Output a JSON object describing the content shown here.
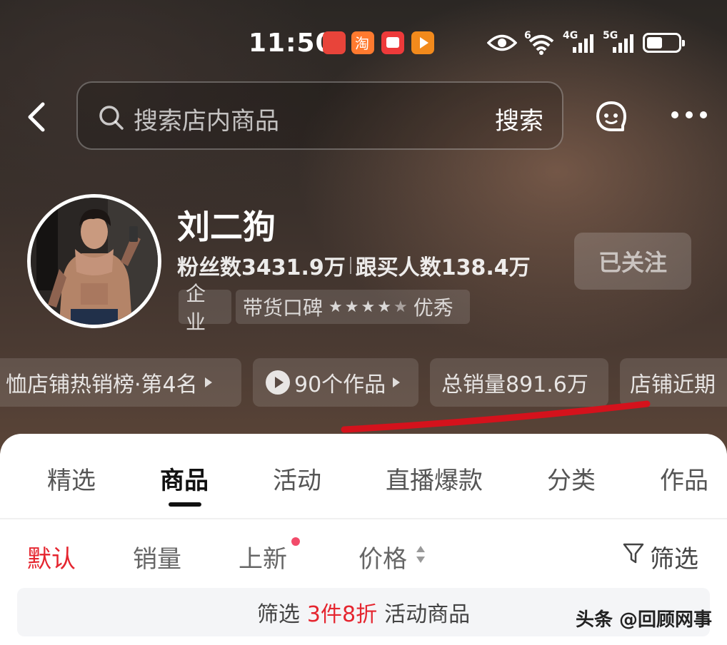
{
  "status_bar": {
    "time": "11:50",
    "apps": [
      {
        "icon": "huawei-store-icon",
        "color": "#e8443a"
      },
      {
        "icon": "taobao-icon",
        "color": "#ff7a2f"
      },
      {
        "icon": "app-red-icon",
        "color": "#ee3a3a"
      },
      {
        "icon": "video-play-icon",
        "color": "#f28a1c"
      }
    ],
    "wifi_label": "6",
    "signal1_label": "4G",
    "signal2_label": "5G",
    "battery_level": 0.5
  },
  "header": {
    "search_placeholder": "搜索店内商品",
    "search_button": "搜索"
  },
  "profile": {
    "shop_name": "刘二狗",
    "fans": "粉丝数3431.9万",
    "buyers": "跟买人数138.4万",
    "follow_button": "已关注",
    "tag_enterprise": "企业",
    "tag_reputation_label": "带货口碑",
    "rating": 4.5,
    "tag_reputation_value": "优秀"
  },
  "chips": {
    "hot_rank": "恤店铺热销榜·第4名",
    "works": "90个作品",
    "total_sales": "总销量891.6万",
    "recent": "店铺近期"
  },
  "tabs": [
    "精选",
    "商品",
    "活动",
    "直播爆款",
    "分类",
    "作品"
  ],
  "active_tab": "商品",
  "sort_bar": {
    "default": "默认",
    "sales": "销量",
    "new": "上新",
    "price": "价格",
    "filter": "筛选"
  },
  "promo": {
    "prefix": "筛选",
    "highlight": "3件8折",
    "suffix": "活动商品"
  },
  "watermark": "头条 @回顾网事",
  "colors": {
    "accent_red": "#e5252f",
    "underline_red": "#d4121c"
  }
}
